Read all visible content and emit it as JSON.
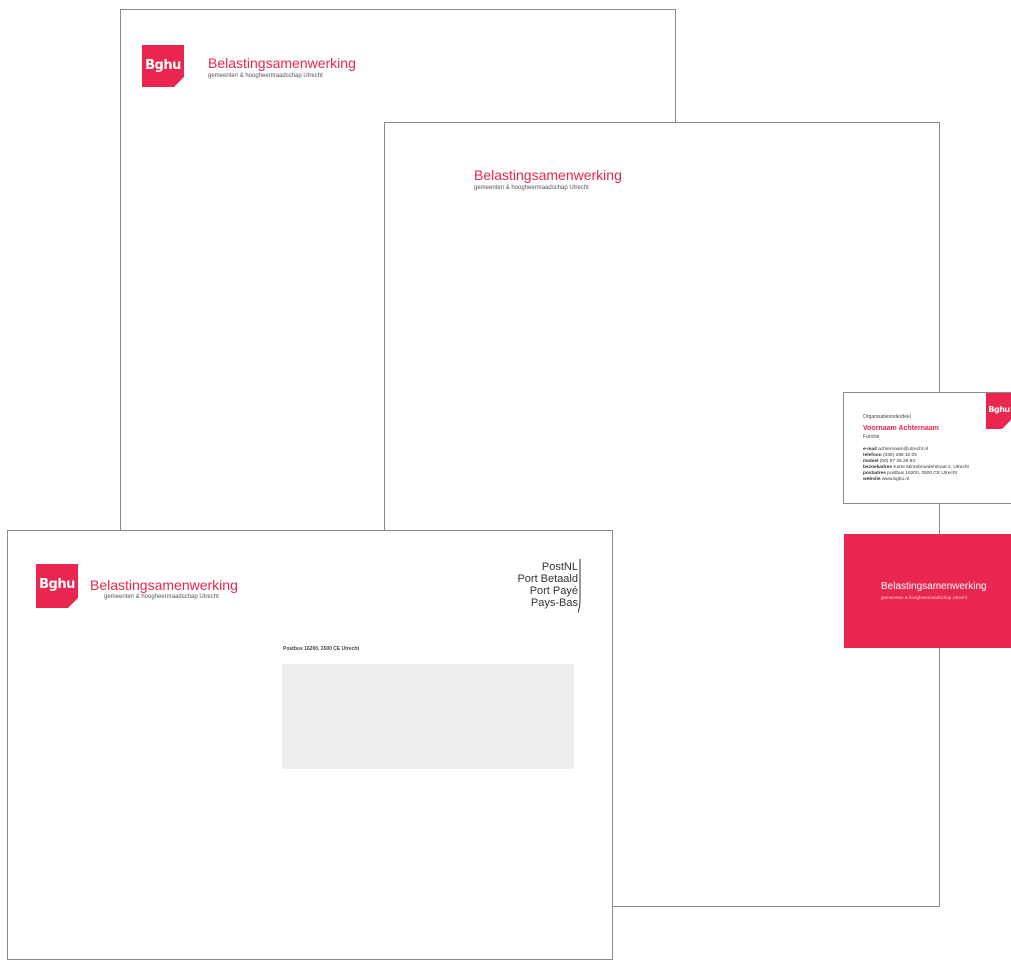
{
  "brand": {
    "logo_text": "Bghu",
    "name": "Belastingsamenwerking",
    "subtitle": "gemeenten & hoogheemraadschap Utrecht",
    "accent_color": "#e8264f"
  },
  "envelope": {
    "postage": [
      "PostNL",
      "Port Betaald",
      "Port Payé",
      "Pays-Bas"
    ],
    "return_address": "Postbus 16200, 3500 CE Utrecht"
  },
  "business_card": {
    "department": "Organisatieonderdeel",
    "name": "Voornaam Achternaam",
    "function": "Functie",
    "contacts": [
      {
        "label": "e-mail",
        "value": "achternaam@utrecht.nl"
      },
      {
        "label": "telefoon",
        "value": "(030) 286 16 05"
      },
      {
        "label": "mobiel",
        "value": "(06) 67 26 29 83"
      },
      {
        "label": "bezoekadres",
        "value": "Korte Minrebroederstraat 2, Utrecht"
      },
      {
        "label": "postadres",
        "value": "postbus 16200, 3500 CE Utrecht"
      },
      {
        "label": "website",
        "value": "www.bghu.nl"
      }
    ]
  }
}
